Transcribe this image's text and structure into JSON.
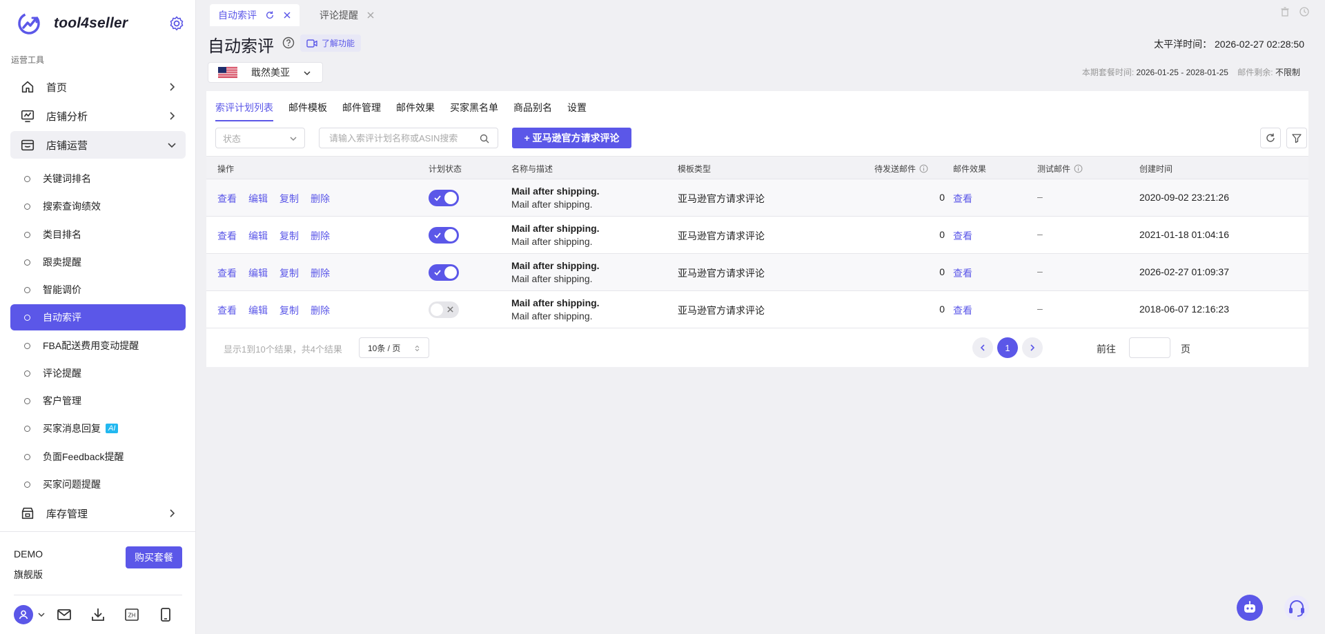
{
  "brand": {
    "name": "tool4seller"
  },
  "sidebar": {
    "section_label": "运营工具",
    "top_items": [
      {
        "label": "首页",
        "icon": "home-icon"
      },
      {
        "label": "店铺分析",
        "icon": "analytics-icon"
      },
      {
        "label": "店铺运营",
        "icon": "store-ops-icon"
      }
    ],
    "sub_items": [
      {
        "label": "关键词排名"
      },
      {
        "label": "搜索查询绩效"
      },
      {
        "label": "类目排名"
      },
      {
        "label": "跟卖提醒"
      },
      {
        "label": "智能调价"
      },
      {
        "label": "自动索评"
      },
      {
        "label": "FBA配送费用变动提醒"
      },
      {
        "label": "评论提醒"
      },
      {
        "label": "客户管理"
      },
      {
        "label": "买家消息回复",
        "badge": "AI"
      },
      {
        "label": "负面Feedback提醒"
      },
      {
        "label": "买家问题提醒"
      }
    ],
    "inventory_item": {
      "label": "库存管理"
    },
    "footer": {
      "plan_name": "DEMO",
      "plan_tier": "旗舰版",
      "buy_label": "购买套餐",
      "lang_label": "ZH"
    }
  },
  "tabs": [
    {
      "label": "自动索评",
      "active": true
    },
    {
      "label": "评论提醒",
      "active": false
    }
  ],
  "header": {
    "title": "自动索评",
    "learn_label": "了解功能",
    "pacific_time": "太平洋时间： 2026-02-27 02:28:50",
    "region": "戢然美亚",
    "plan_period_label": "本期套餐时间:",
    "plan_period_value": "2026-01-25 - 2028-01-25",
    "mail_remaining_label": "邮件剩余:",
    "mail_remaining_value": "不限制"
  },
  "subtabs": [
    "索评计划列表",
    "邮件模板",
    "邮件管理",
    "邮件效果",
    "买家黑名单",
    "商品别名",
    "设置"
  ],
  "filters": {
    "status_placeholder": "状态",
    "search_placeholder": "请输入索评计划名称或ASIN搜索",
    "add_button": "+ 亚马逊官方请求评论"
  },
  "table": {
    "headers": {
      "actions": "操作",
      "status": "计划状态",
      "name": "名称与描述",
      "template": "模板类型",
      "pending": "待发送邮件",
      "effect": "邮件效果",
      "test": "测试邮件",
      "created": "创建时间"
    },
    "action_labels": {
      "view": "查看",
      "edit": "编辑",
      "copy": "复制",
      "delete": "删除"
    },
    "rows": [
      {
        "enabled": true,
        "name": "Mail after shipping.",
        "desc": "Mail after shipping.",
        "template": "亚马逊官方请求评论",
        "pending": "0",
        "effect": "查看",
        "test": "–",
        "created": "2020-09-02 23:21:26"
      },
      {
        "enabled": true,
        "name": "Mail after shipping.",
        "desc": "Mail after shipping.",
        "template": "亚马逊官方请求评论",
        "pending": "0",
        "effect": "查看",
        "test": "–",
        "created": "2021-01-18 01:04:16"
      },
      {
        "enabled": true,
        "name": "Mail after shipping.",
        "desc": "Mail after shipping.",
        "template": "亚马逊官方请求评论",
        "pending": "0",
        "effect": "查看",
        "test": "–",
        "created": "2026-02-27 01:09:37"
      },
      {
        "enabled": false,
        "name": "Mail after shipping.",
        "desc": "Mail after shipping.",
        "template": "亚马逊官方请求评论",
        "pending": "0",
        "effect": "查看",
        "test": "–",
        "created": "2018-06-07 12:16:23"
      }
    ]
  },
  "pagination": {
    "summary": "显示1到10个结果，共4个结果",
    "page_size": "10条 / 页",
    "current_page": "1",
    "goto_label": "前往",
    "page_suffix": "页"
  },
  "colors": {
    "accent": "#5b57e8",
    "background": "#f0f0f3"
  }
}
